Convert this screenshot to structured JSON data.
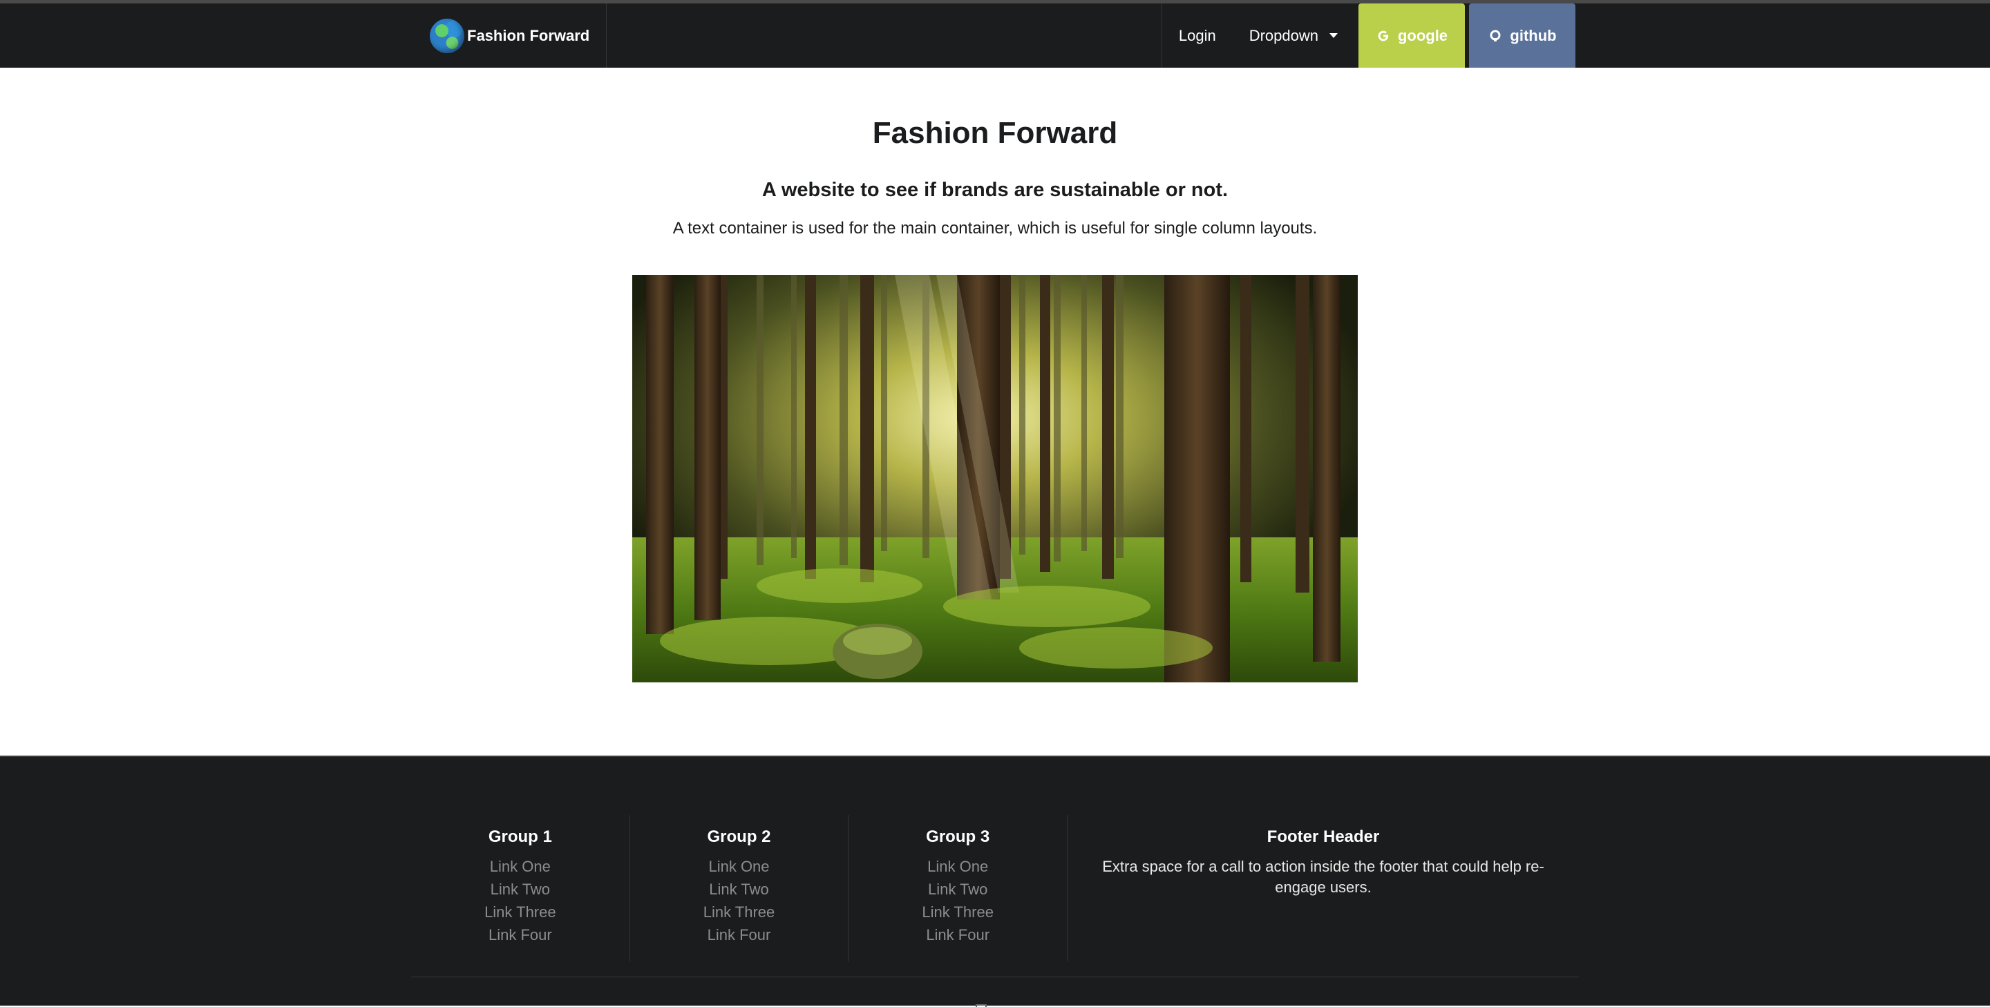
{
  "navbar": {
    "brand": "Fashion Forward",
    "login": "Login",
    "dropdown": "Dropdown",
    "google": "google",
    "github": "github"
  },
  "main": {
    "title": "Fashion Forward",
    "subtitle": "A website to see if brands are sustainable or not.",
    "description": "A text container is used for the main container, which is useful for single column layouts."
  },
  "footer": {
    "groups": [
      {
        "title": "Group 1",
        "links": [
          "Link One",
          "Link Two",
          "Link Three",
          "Link Four"
        ]
      },
      {
        "title": "Group 2",
        "links": [
          "Link One",
          "Link Two",
          "Link Three",
          "Link Four"
        ]
      },
      {
        "title": "Group 3",
        "links": [
          "Link One",
          "Link Two",
          "Link Three",
          "Link Four"
        ]
      }
    ],
    "cta_header": "Footer Header",
    "cta_text": "Extra space for a call to action inside the footer that could help re-engage users."
  },
  "colors": {
    "navbar_bg": "#1b1c1d",
    "google_btn": "#bad04b",
    "github_btn": "#5a7299",
    "footer_link": "#8c8d8e"
  },
  "icons": {
    "logo": "earth-globe-icon",
    "dropdown": "caret-down-icon",
    "google": "google-icon",
    "github": "github-icon"
  }
}
